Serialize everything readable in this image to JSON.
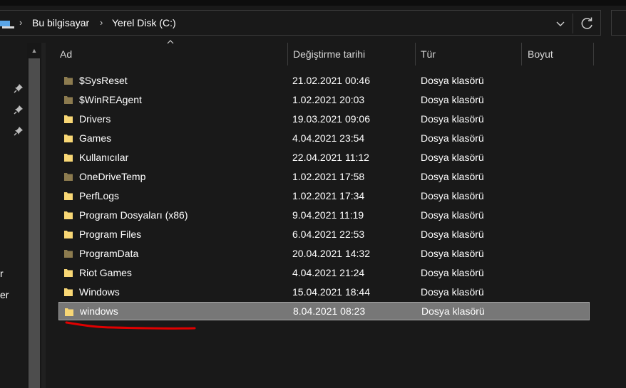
{
  "address_bar": {
    "breadcrumbs": [
      {
        "label": "Bu bilgisayar"
      },
      {
        "label": "Yerel Disk (C:)"
      }
    ],
    "separator_glyph": "›",
    "dropdown_glyph": "⌄",
    "icons": {
      "location": "this-pc-icon",
      "refresh": "refresh-icon",
      "dropdown": "chevron-down-icon"
    }
  },
  "nav_pane": {
    "pinned_count": 3,
    "truncated_labels": [
      "r",
      "er"
    ]
  },
  "columns": {
    "name": "Ad",
    "date": "Değiştirme tarihi",
    "type": "Tür",
    "size": "Boyut",
    "sorted_by": "name",
    "sort_icon": "sort-ascending-icon"
  },
  "files": [
    {
      "name": "$SysReset",
      "date": "21.02.2021 00:46",
      "type": "Dosya klasörü",
      "hidden": true
    },
    {
      "name": "$WinREAgent",
      "date": "1.02.2021 20:03",
      "type": "Dosya klasörü",
      "hidden": true
    },
    {
      "name": "Drivers",
      "date": "19.03.2021 09:06",
      "type": "Dosya klasörü",
      "hidden": false
    },
    {
      "name": "Games",
      "date": "4.04.2021 23:54",
      "type": "Dosya klasörü",
      "hidden": false
    },
    {
      "name": "Kullanıcılar",
      "date": "22.04.2021 11:12",
      "type": "Dosya klasörü",
      "hidden": false
    },
    {
      "name": "OneDriveTemp",
      "date": "1.02.2021 17:58",
      "type": "Dosya klasörü",
      "hidden": true
    },
    {
      "name": "PerfLogs",
      "date": "1.02.2021 17:34",
      "type": "Dosya klasörü",
      "hidden": false
    },
    {
      "name": "Program Dosyaları (x86)",
      "date": "9.04.2021 11:19",
      "type": "Dosya klasörü",
      "hidden": false
    },
    {
      "name": "Program Files",
      "date": "6.04.2021 22:53",
      "type": "Dosya klasörü",
      "hidden": false
    },
    {
      "name": "ProgramData",
      "date": "20.04.2021 14:32",
      "type": "Dosya klasörü",
      "hidden": true
    },
    {
      "name": "Riot Games",
      "date": "4.04.2021 21:24",
      "type": "Dosya klasörü",
      "hidden": false
    },
    {
      "name": "Windows",
      "date": "15.04.2021 18:44",
      "type": "Dosya klasörü",
      "hidden": false
    },
    {
      "name": "windows",
      "date": "8.04.2021 08:23",
      "type": "Dosya klasörü",
      "hidden": false,
      "selected": true
    }
  ],
  "colors": {
    "background": "#191919",
    "selection": "#777777",
    "folder": "#f8d775",
    "folder_hidden": "#8c7b4f",
    "annotation": "#e00000"
  }
}
